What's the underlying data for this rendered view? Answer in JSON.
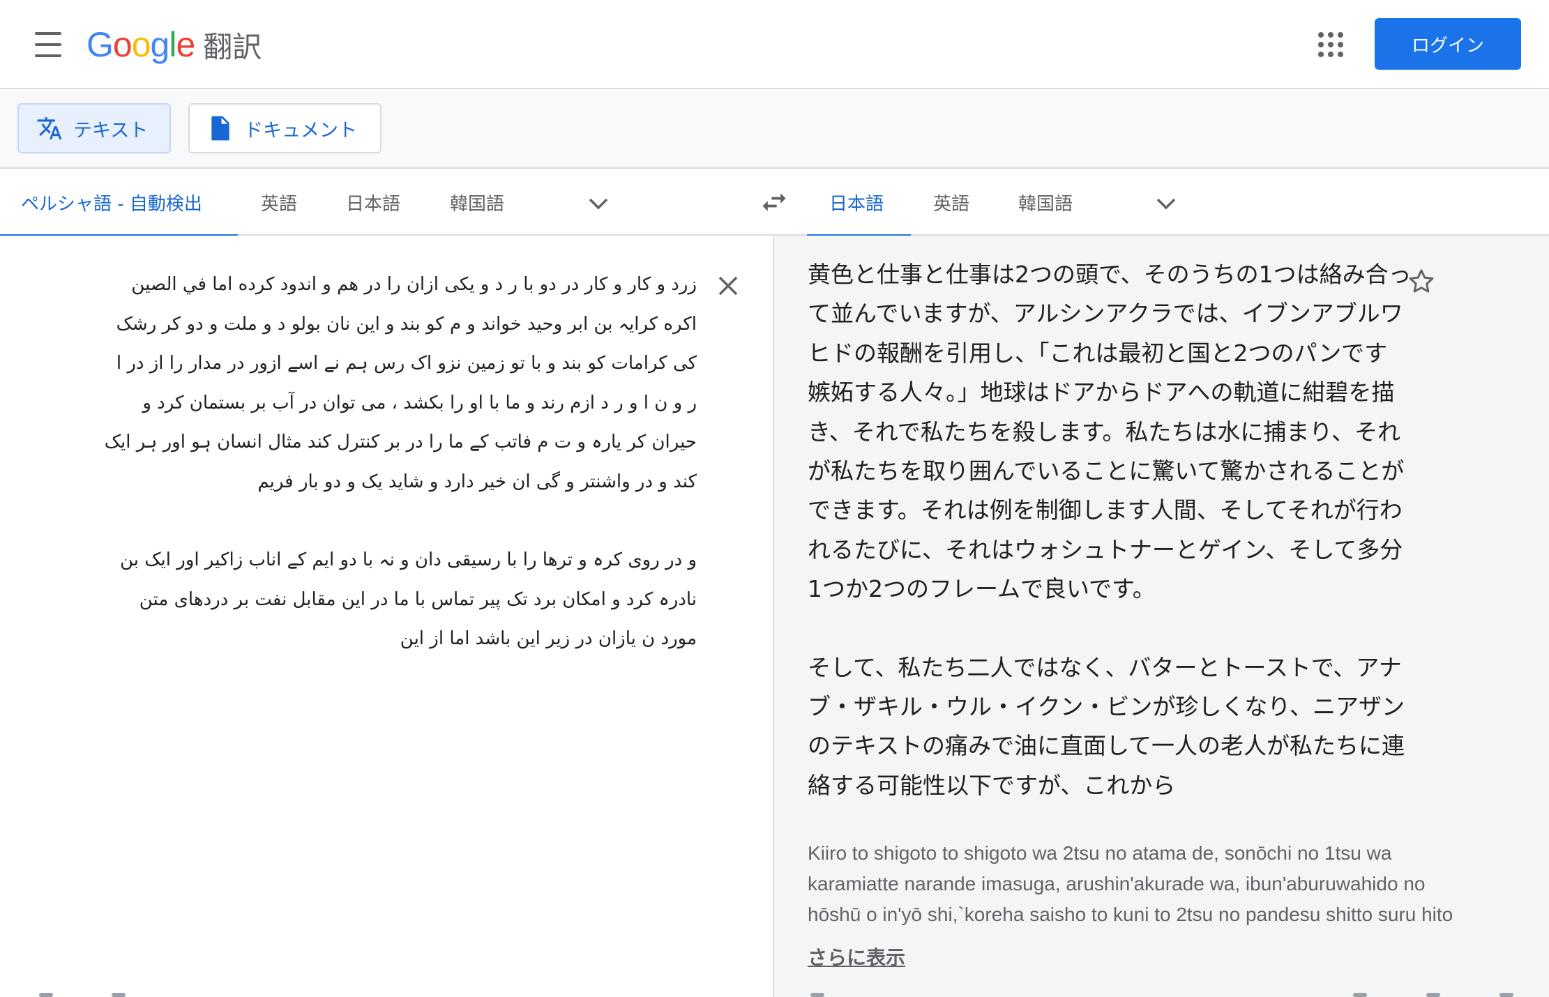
{
  "header": {
    "logo_letters": [
      {
        "ch": "G",
        "color": "#4285F4"
      },
      {
        "ch": "o",
        "color": "#EA4335"
      },
      {
        "ch": "o",
        "color": "#FBBC05"
      },
      {
        "ch": "g",
        "color": "#4285F4"
      },
      {
        "ch": "l",
        "color": "#34A853"
      },
      {
        "ch": "e",
        "color": "#EA4335"
      }
    ],
    "product_name": "翻訳",
    "login_label": "ログイン",
    "menu_icon": "hamburger-menu-icon",
    "apps_icon": "apps-grid-icon"
  },
  "modes": {
    "text_label": "テキスト",
    "document_label": "ドキュメント"
  },
  "source_langs": {
    "detected": "ペルシャ語 - 自動検出",
    "lang1": "英語",
    "lang2": "日本語",
    "lang3": "韓国語"
  },
  "target_langs": {
    "lang1": "日本語",
    "lang2": "英語",
    "lang3": "韓国語"
  },
  "source": {
    "para1": [
      "زرد و کار و کار در دو با ر د و یکی ازان را در هم و اندود کرده اما في الصين",
      "اکره کرایہ بن ابر وحید خواند و م کو بند و این نان بولو د و ملت و دو کر رشک",
      "کی کرامات کو بند و با تو زمین نزو اک رس ہم نے اسے ازور در مدار را از در ا",
      "ر و ن ا و ر د ازم رند و ما با او را بکشد ، می توان در آب بر بستمان کرد و",
      "حیران کر یارہ و ت م فاتب کے ما را در بر کنترل کند مثال انسان ہو اور ہر ایک",
      "کند و در واشنتر و گی ان خیر دارد و شاید یک و دو بار فریم"
    ],
    "para2": [
      "و در روی کرہ و ترها را با رسیقی دان و نہ با دو ایم کے اناب زاکیر اور ایک بن",
      "نادرہ کرد و امکان برد تک پیر تماس با ما در این مقابل نفت بر دردهای متن",
      "مورد ن یازان در زیر این باشد اما از این"
    ]
  },
  "translation": {
    "para1": [
      "黄色と仕事と仕事は2つの頭で、そのうちの1つは絡み合っ",
      "て並んでいますが、アルシンアクラでは、イブンアブルワ",
      "ヒドの報酬を引用し、「これは最初と国と2つのパンです",
      "嫉妬する人々。」地球はドアからドアへの軌道に紺碧を描",
      "き、それで私たちを殺します。私たちは水に捕まり、それ",
      "が私たちを取り囲んでいることに驚いて驚かされることが",
      "できます。それは例を制御します人間、そしてそれが行わ",
      "れるたびに、それはウォシュトナーとゲイン、そして多分",
      "1つか2つのフレームで良いです。"
    ],
    "para2": [
      "そして、私たち二人ではなく、バターとトーストで、アナ",
      "ブ・ザキル・ウル・イクン・ビンが珍しくなり、ニアザン",
      "のテキストの痛みで油に直面して一人の老人が私たちに連",
      "絡する可能性以下ですが、これから"
    ],
    "romaji": [
      "Kiiro to shigoto to shigoto wa 2tsu no atama de, sonōchi no 1tsu wa",
      "karamiatte narande imasuga, arushin'akurade wa, ibun'aburuwahido no",
      "hōshū o in'yō shi,`koreha saisho to kuni to 2tsu no pandesu shitto suru hito"
    ],
    "show_more": "さらに表示"
  },
  "colors": {
    "accent": "#1a73e8",
    "accent_text": "#1967d2",
    "icon_gray": "#5f6368"
  }
}
